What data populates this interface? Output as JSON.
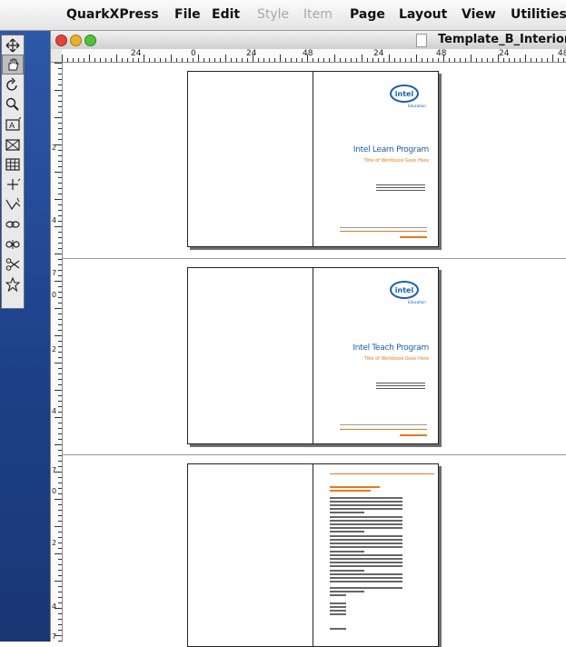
{
  "menubar": {
    "items": [
      {
        "label": "QuarkXPress",
        "enabled": true
      },
      {
        "label": "File",
        "enabled": true
      },
      {
        "label": "Edit",
        "enabled": true
      },
      {
        "label": "Style",
        "enabled": false
      },
      {
        "label": "Item",
        "enabled": false
      },
      {
        "label": "Page",
        "enabled": true
      },
      {
        "label": "Layout",
        "enabled": true
      },
      {
        "label": "View",
        "enabled": true
      },
      {
        "label": "Utilities",
        "enabled": true
      }
    ]
  },
  "window": {
    "title": "Template_B_Interior_A"
  },
  "ruler": {
    "h_labels": [
      "24",
      "0",
      "24",
      "48",
      "24",
      "48",
      "24",
      "48"
    ],
    "v_labels": [
      "2",
      "4",
      "7",
      "0",
      "2",
      "4",
      "7",
      "0",
      "2",
      "4",
      "7"
    ]
  },
  "tools": [
    {
      "name": "item-tool",
      "icon": "move-icon"
    },
    {
      "name": "content-tool",
      "icon": "hand-icon",
      "active": true
    },
    {
      "name": "rotation-tool",
      "icon": "rotate-icon"
    },
    {
      "name": "zoom-tool",
      "icon": "magnifier-icon"
    },
    {
      "name": "text-box-tool",
      "icon": "text-box-icon"
    },
    {
      "name": "picture-box-tool",
      "icon": "picture-box-icon"
    },
    {
      "name": "table-tool",
      "icon": "table-icon"
    },
    {
      "name": "line-tool",
      "icon": "line-icon"
    },
    {
      "name": "bezier-tool",
      "icon": "pen-icon"
    },
    {
      "name": "link-tool",
      "icon": "link-icon"
    },
    {
      "name": "unlink-tool",
      "icon": "unlink-icon"
    },
    {
      "name": "scissors-tool",
      "icon": "scissors-icon"
    },
    {
      "name": "star-tool",
      "icon": "star-icon"
    }
  ],
  "spreads": [
    {
      "logo": "intel",
      "logo_tag": "Education",
      "title": "Intel Learn Program",
      "subtitle": "Title of Workbook Goes Here"
    },
    {
      "logo": "intel",
      "logo_tag": "Education",
      "title": "Intel Teach Program",
      "subtitle": "Title of Workbook Goes Here"
    },
    {
      "logo": "",
      "title": "",
      "subtitle": ""
    }
  ],
  "colors": {
    "intel_blue": "#1a5fb4",
    "accent_orange": "#e8791a",
    "desktop_blue": "#1c3f86"
  }
}
